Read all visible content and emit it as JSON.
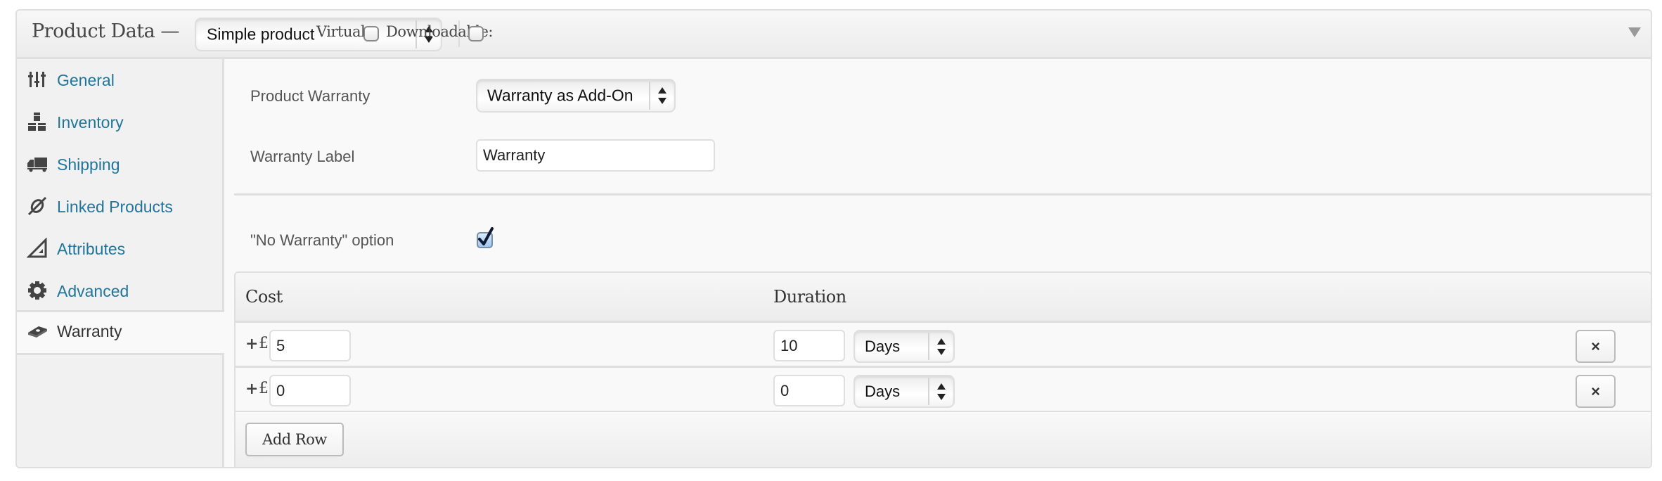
{
  "header": {
    "title": "Product Data —",
    "product_type": "Simple product",
    "virtual_label": "Virtual:",
    "virtual_checked": false,
    "downloadable_label": "Downloadable:",
    "downloadable_checked": false
  },
  "sidebar": {
    "items": [
      {
        "label": "General",
        "icon": "sliders-icon",
        "active": false
      },
      {
        "label": "Inventory",
        "icon": "boxes-icon",
        "active": false
      },
      {
        "label": "Shipping",
        "icon": "truck-icon",
        "active": false
      },
      {
        "label": "Linked Products",
        "icon": "link-icon",
        "active": false
      },
      {
        "label": "Attributes",
        "icon": "set-square-icon",
        "active": false
      },
      {
        "label": "Advanced",
        "icon": "gear-icon",
        "active": false
      },
      {
        "label": "Warranty",
        "icon": "warranty-ticket-icon",
        "active": true
      }
    ]
  },
  "main": {
    "product_warranty_label": "Product Warranty",
    "product_warranty_value": "Warranty as Add-On",
    "warranty_label_label": "Warranty Label",
    "warranty_label_value": "Warranty",
    "no_warranty_label": "\"No Warranty\" option",
    "no_warranty_checked": true,
    "table": {
      "headers": {
        "cost": "Cost",
        "duration": "Duration"
      },
      "plus": "+",
      "currency": "£",
      "rows": [
        {
          "cost": "5",
          "duration": "10",
          "unit": "Days",
          "remove": "×"
        },
        {
          "cost": "0",
          "duration": "0",
          "unit": "Days",
          "remove": "×"
        }
      ],
      "add_row_label": "Add Row"
    }
  }
}
